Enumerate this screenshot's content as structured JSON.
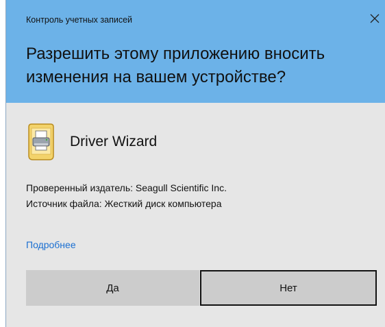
{
  "dialog": {
    "title": "Контроль учетных записей",
    "close_glyph": "✕",
    "question": "Разрешить этому приложению вносить изменения на вашем устройстве?",
    "app": {
      "name": "Driver Wizard",
      "icon": "printer-setup-icon"
    },
    "publisher_line": "Проверенный издатель: Seagull Scientific Inc.",
    "source_line": "Источник файла: Жесткий диск компьютера",
    "more_link": "Подробнее",
    "buttons": {
      "yes": "Да",
      "no": "Нет"
    }
  },
  "colors": {
    "header_bg": "#6cb2e8",
    "body_bg": "#e6e6e6",
    "button_bg": "#cccccc",
    "link": "#1a6fd1",
    "focus_border": "#111111"
  }
}
